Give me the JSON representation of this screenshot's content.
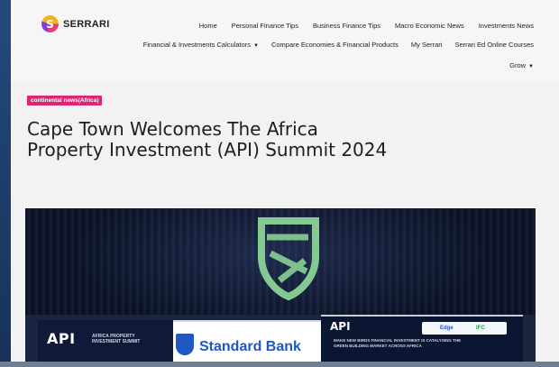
{
  "site": {
    "logo_text": "SERRARI",
    "logo_icon": "serrari-logo-icon"
  },
  "nav": {
    "row1": [
      "Home",
      "Personal Finance Tips",
      "Business Finance Tips",
      "Macro Economic News",
      "Investments News"
    ],
    "row2": [
      {
        "label": "Financial & Investments Calculators",
        "has_dropdown": true
      },
      {
        "label": "Compare Economies & Financial Products",
        "has_dropdown": false
      },
      {
        "label": "My Serrari",
        "has_dropdown": false
      },
      {
        "label": "Serrari Ed Online Courses",
        "has_dropdown": false
      }
    ],
    "row3": [
      {
        "label": "Grow",
        "has_dropdown": true
      }
    ]
  },
  "article": {
    "category": "continental news(Africa)",
    "title": "Cape Town Welcomes The Africa Property Investment (API) Summit 2024"
  },
  "hero": {
    "banner_left_badge": "API",
    "banner_left_sub": "AFRICA PROPERTY INVESTMENT SUMMIT",
    "sponsor": "Standard Bank",
    "banner_right_title": "API",
    "banner_right_sub": "MAKE NEW BIRDS FINANCIAL INVESTMENT IS CATALYSING THE GREEN BUILDING MARKET ACROSS AFRICA",
    "chip_left": "Edge",
    "chip_right": "IFC"
  },
  "colors": {
    "accent": "#e0246f",
    "sponsor_blue": "#1f57c3",
    "shield_green": "#8fdc9a"
  }
}
